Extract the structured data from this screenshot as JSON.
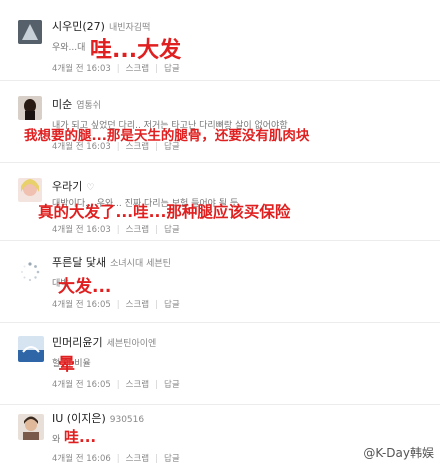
{
  "comments": [
    {
      "name": "시우민(27)",
      "sub": "내빈자김떡",
      "text": "우와...대",
      "time": "4개월 전 16:03",
      "scrap": "스크랩",
      "reply": "답글",
      "overlay": "哇...大发",
      "avatar_color": "#7a8a9a"
    },
    {
      "name": "미순",
      "sub": "엽통쉬",
      "text": "내가 되고 싶었던 다리.. 저거는 타고난 다리뼈랑 살이 없어야함",
      "time": "4개월 전 16:03",
      "scrap": "스크랩",
      "reply": "답글",
      "overlay": "我想要的腿...那是天生的腿骨，还要没有肌肉块",
      "avatar_color": "#3a2a22"
    },
    {
      "name": "우라기",
      "sub": "♡",
      "text": "대박이다... 우와... 진짜 다리는 보험 들어야 될 듯",
      "time": "4개월 전 16:03",
      "scrap": "스크랩",
      "reply": "답글",
      "overlay": "真的大发了...哇...那种腿应该买保险",
      "avatar_color": "#e8b0b8"
    },
    {
      "name": "푸른달 닻새",
      "sub": "소녀시대 세븐틴",
      "text": "대박",
      "time": "4개월 전 16:05",
      "scrap": "스크랩",
      "reply": "답글",
      "overlay": "大发...",
      "avatar_color": "#ffffff"
    },
    {
      "name": "민머리윤기",
      "sub": "세븐틴아이엔",
      "text": "헐 이 비율",
      "time": "4개월 전 16:05",
      "scrap": "스크랩",
      "reply": "답글",
      "overlay": "晕",
      "avatar_color": "#3a6fb0"
    },
    {
      "name": "IU (이지은)",
      "sub": "930516",
      "text": "와",
      "time": "4개월 전 16:06",
      "scrap": "스크랩",
      "reply": "답글",
      "overlay": "哇...",
      "avatar_color": "#b08a70"
    }
  ],
  "watermark": "@K-Day韩娱"
}
